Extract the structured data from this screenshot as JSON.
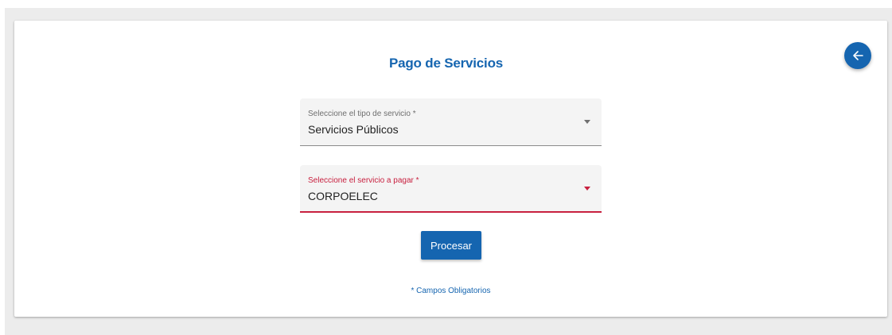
{
  "page": {
    "title": "Pago de Servicios",
    "back_icon": "arrow-left-icon",
    "required_note": "* Campos Obligatorios"
  },
  "form": {
    "service_type": {
      "label": "Seleccione el tipo de servicio *",
      "value": "Servicios Públicos",
      "icon": "chevron-down-icon"
    },
    "service_to_pay": {
      "label": "Seleccione el servicio a pagar *",
      "value": "CORPOELEC",
      "icon": "chevron-down-icon",
      "state": "invalid"
    },
    "submit_label": "Procesar"
  },
  "colors": {
    "accent": "#1565b0",
    "error": "#c8203f",
    "field_bg": "#f4f4f4",
    "page_bg": "#ececec"
  }
}
